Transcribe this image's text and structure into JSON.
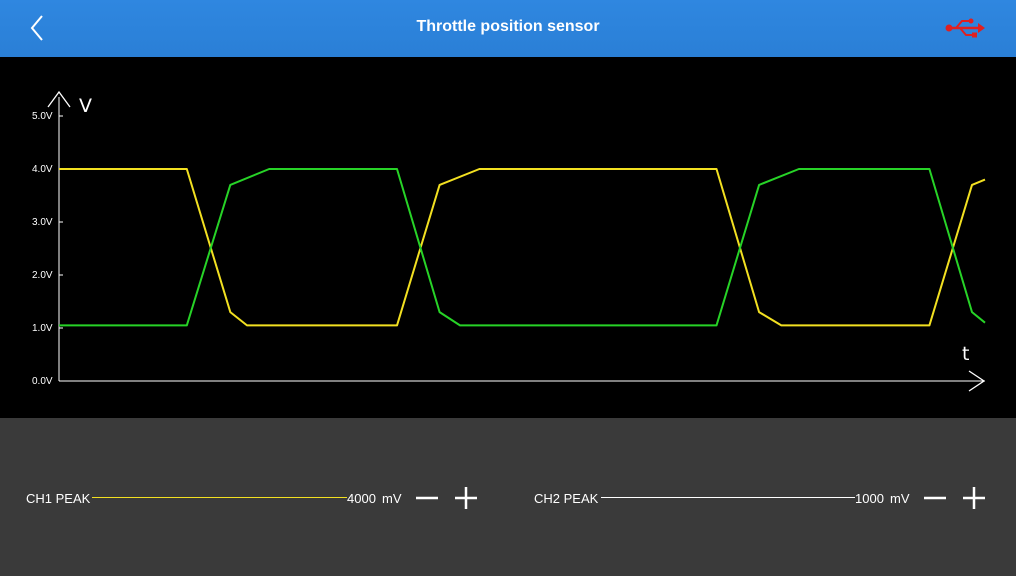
{
  "header": {
    "title": "Throttle position sensor",
    "back_icon": "chevron-left-icon",
    "usb_icon": "usb-icon",
    "usb_color": "#e02020"
  },
  "chart_data": {
    "type": "line",
    "xlabel": "t",
    "ylabel": "V",
    "ylim": [
      0,
      5
    ],
    "yticks": [
      "0.0V",
      "1.0V",
      "2.0V",
      "3.0V",
      "4.0V",
      "5.0V"
    ],
    "grid": false,
    "series": [
      {
        "color": "#f2e021",
        "x": [
          0,
          13.8,
          18.5,
          20.3,
          36.5,
          41.1,
          45.4,
          71.0,
          75.6,
          78.0,
          94.0,
          98.6,
          100
        ],
        "values": [
          4.0,
          4.0,
          1.3,
          1.05,
          1.05,
          3.7,
          4.0,
          4.0,
          1.3,
          1.05,
          1.05,
          3.7,
          3.8
        ]
      },
      {
        "color": "#27d327",
        "x": [
          0,
          13.8,
          18.5,
          22.7,
          36.5,
          41.1,
          43.3,
          71.0,
          75.6,
          79.9,
          94.0,
          98.6,
          100
        ],
        "values": [
          1.05,
          1.05,
          3.7,
          4.0,
          4.0,
          1.3,
          1.05,
          1.05,
          3.7,
          4.0,
          4.0,
          1.3,
          1.1
        ]
      }
    ]
  },
  "controls": {
    "ch1": {
      "label": "CH1 PEAK",
      "value": "4000",
      "unit": "mV",
      "line_color": "#f2e021"
    },
    "ch2": {
      "label": "CH2 PEAK",
      "value": "1000",
      "unit": "mV",
      "line_color": "#ffffff"
    }
  }
}
